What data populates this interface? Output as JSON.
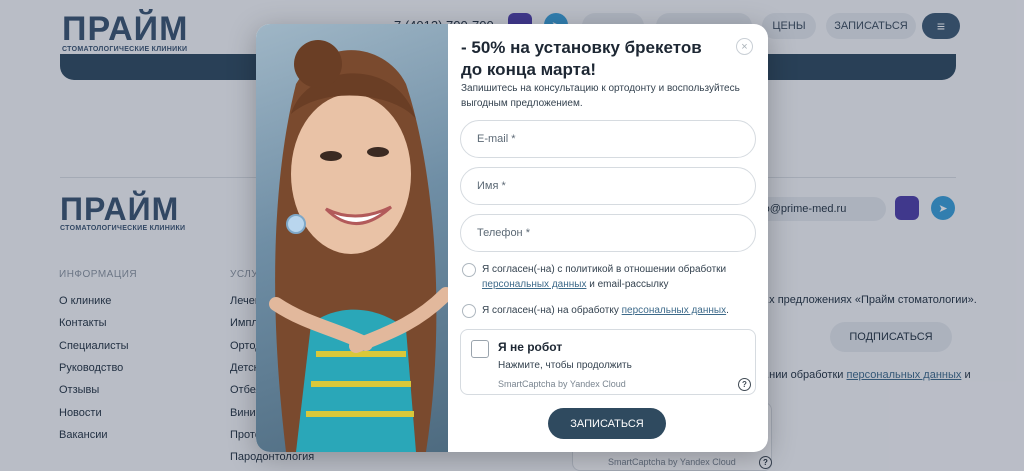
{
  "header": {
    "logo_big": "ПРАЙМ",
    "logo_small": "СТОМАТОЛОГИЧЕСКИЕ КЛИНИКИ",
    "phone": "7 (4012) 700-700",
    "nav_prices": "ЦЕНЫ",
    "nav_signup": "ЗАПИСАТЬСЯ",
    "menu_icon": "≡"
  },
  "footer": {
    "logo_big": "ПРАЙМ",
    "logo_small": "СТОМАТОЛОГИЧЕСКИЕ КЛИНИКИ",
    "email": "info@prime-med.ru",
    "col_info_title": "ИНФОРМАЦИЯ",
    "col_services_title": "УСЛУГИ",
    "info_links": [
      "О клинике",
      "Контакты",
      "Специалисты",
      "Руководство",
      "Отзывы",
      "Новости",
      "Вакансии"
    ],
    "service_links": [
      "Лечение",
      "Имплантация",
      "Ортодонтия",
      "Детская",
      "Отбеливание",
      "Виниры",
      "Протезирование",
      "Пародонтология"
    ],
    "promo_text": "...х предложениях «Прайм стоматологии».",
    "subscribe_label": "ПОДПИСАТЬСЯ",
    "policy_text": "...нии обработки",
    "policy_link": "персональных данных",
    "policy_tail": "и",
    "captcha_brand": "SmartCaptcha by Yandex Cloud"
  },
  "modal": {
    "title": "- 50% на установку брекетов до конца марта!",
    "subtitle": "Запишитесь на консультацию к ортодонту и воспользуйтесь выгодным предложением.",
    "close_icon": "×",
    "email_placeholder": "E-mail *",
    "name_placeholder": "Имя *",
    "phone_placeholder": "Телефон *",
    "consent1_text": "Я согласен(-на) с политикой в отношении обработки",
    "consent1_link": "персональных данных",
    "consent1_tail": "и email-рассылку",
    "consent2_text": "Я согласен(-на) на обработку",
    "consent2_link": "персональных данных",
    "consent2_tail": ".",
    "captcha_title": "Я не робот",
    "captcha_hint": "Нажмите, чтобы продолжить",
    "captcha_brand": "SmartCaptcha by Yandex Cloud",
    "captcha_help": "?",
    "submit_label": "ЗАПИСАТЬСЯ"
  },
  "colors": {
    "accent": "#2f4a5f",
    "link": "#3d6a8a",
    "telegram": "#3aa0d8"
  }
}
